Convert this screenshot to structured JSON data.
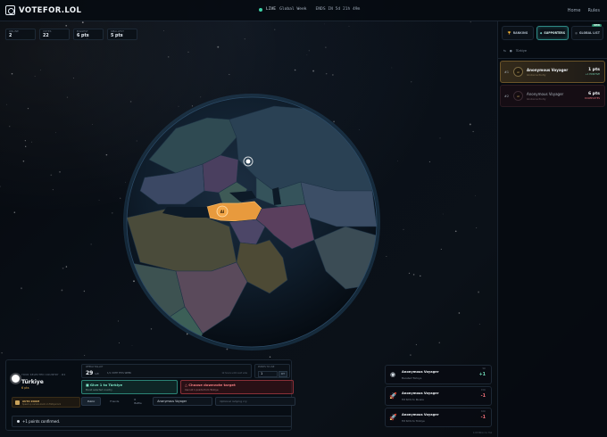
{
  "header": {
    "logo": "VOTEFOR.LOL",
    "live_label": "LIVE",
    "period": "Global Week",
    "ends_text": "ENDS IN  5d 21h 49m",
    "nav": [
      "Home",
      "Rules"
    ]
  },
  "stats": [
    {
      "label": "ONLINE",
      "value": "2"
    },
    {
      "label": "VOTES",
      "value": "22"
    },
    {
      "label": "BIGGEST",
      "value": "6 pts"
    },
    {
      "label": "SMALLEST",
      "value": "5 pts"
    }
  ],
  "globe": {
    "highlight_country": "Türkiye",
    "marker_label": "AI",
    "colors": {
      "highlight": "#e89a3d",
      "ocean": "#0b1724",
      "accent": "#3fd1a6"
    }
  },
  "right_panel": {
    "tabs": [
      {
        "label": "RANKING",
        "icon": "trophy-icon"
      },
      {
        "label": "SUPPORTERS",
        "icon": "users-icon",
        "active": true
      },
      {
        "label": "GLOBAL LIST",
        "icon": "globe-icon",
        "badge": "NEW"
      }
    ],
    "filter_label": "Türkiye",
    "entries": [
      {
        "rank": "#1",
        "avatar": "AI",
        "name": "Anonymous Voyager",
        "sub": "Global activity",
        "points": "1 pts",
        "tag": "+1 POSITIVE",
        "tag_color": "#6fc6a8"
      },
      {
        "rank": "#2",
        "avatar": "AI",
        "name": "Anonymous Voyager",
        "sub": "Global activity",
        "points": "6 pts",
        "tag": "DOWNVOTES",
        "tag_color": "#e0707a"
      }
    ]
  },
  "selection": {
    "label": "YOUR SELECTED COUNTRY · #2",
    "country": "Türkiye",
    "points": "6 pts",
    "ballot_label": "WEEKLY BALLOT",
    "ballot_num": "29",
    "ballot_unit": "left",
    "ballot_mid": "1/1 VOTE THIS WEEK",
    "ballot_right": "12 hours until next vote",
    "points_label": "POINTS TO USE",
    "points_value": "1",
    "set_label": "SET",
    "give_title": "Give 1 to Türkiye",
    "give_sub": "Boost selected country",
    "down_title": "Choose downvote target",
    "down_sub": "Cannot 1 points from Türkiye",
    "tabs": [
      "Public",
      "Friends",
      "R Battle"
    ],
    "sender_name": "Anonymous Voyager",
    "message_placeholder": "Optional rallying cry",
    "autozoom_title": "AUTO ZOOM",
    "autozoom_sub": "Speed up camera zoom on Türkiye lock",
    "confirm_text": "+1 points confirmed."
  },
  "feed": [
    {
      "icon": "globe-dot-icon",
      "icon_glyph": "◉",
      "name": "Anonymous Voyager",
      "sub": "Boosted Türkiye",
      "delta": "+1",
      "delta_color": "#6fd7b5",
      "time": "9m"
    },
    {
      "icon": "rocket-icon",
      "icon_glyph": "🚀",
      "name": "Anonymous Voyager",
      "sub": "Hit 6mS to Russia",
      "delta": "-1",
      "delta_color": "#ef6f78",
      "time": "15m"
    },
    {
      "icon": "rocket-icon",
      "icon_glyph": "🚀",
      "name": "Anonymous Voyager",
      "sub": "Hit 6mS to Türkiye",
      "delta": "-1",
      "delta_color": "#ef6f78",
      "time": "16m"
    }
  ],
  "footnote": "4.93 Million Sc. Feb"
}
